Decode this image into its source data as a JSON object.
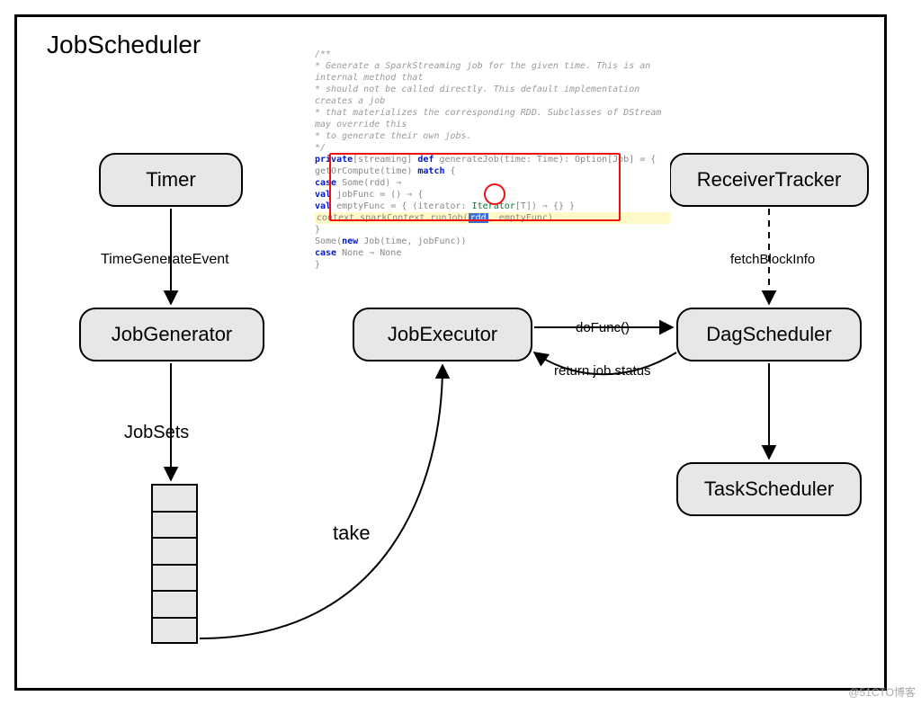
{
  "title": "JobScheduler",
  "nodes": {
    "timer": "Timer",
    "jobGenerator": "JobGenerator",
    "jobExecutor": "JobExecutor",
    "receiverTracker": "ReceiverTracker",
    "dagScheduler": "DagScheduler",
    "taskScheduler": "TaskScheduler"
  },
  "edges": {
    "timeGenerateEvent": "TimeGenerateEvent",
    "jobSets": "JobSets",
    "take": "take",
    "doFunc": "doFunc()",
    "returnJobStatus": "return job status",
    "fetchBlockInfo": "fetchBlockInfo"
  },
  "snippet": {
    "c1": "/**",
    "c2": " * Generate a SparkStreaming job for the given time. This is an internal method that",
    "c3": " * should not be called directly. This default implementation creates a job",
    "c4": " * that materializes the corresponding RDD. Subclasses of DStream may override this",
    "c5": " * to generate their own jobs.",
    "c6": " */",
    "l1a": "private",
    "l1b": "[streaming] ",
    "l1c": "def",
    "l1d": " generateJob(time: Time): Option[Job] = {",
    "l2": "  getOrCompute(time) ",
    "l2m": "match",
    "l2e": " {",
    "l3a": "    case",
    "l3b": " Some(rdd) ⇒",
    "l4a": "      val",
    "l4b": " jobFunc = () ⇒ {",
    "l5a": "        val",
    "l5b": " emptyFunc = { (iterator: ",
    "l5c": "Iterator",
    "l5d": "[T]) ⇒ {} }",
    "l6": "        context.sparkContext.runJob(",
    "l6h": "rdd",
    "l6e": ", emptyFunc)",
    "l7": "      }",
    "l8a": "      Some(",
    "l8b": "new",
    "l8c": " Job(time, jobFunc))",
    "l9a": "    case",
    "l9b": " None ⇒ None",
    "l10": "}"
  },
  "watermark": "@51CTO博客"
}
